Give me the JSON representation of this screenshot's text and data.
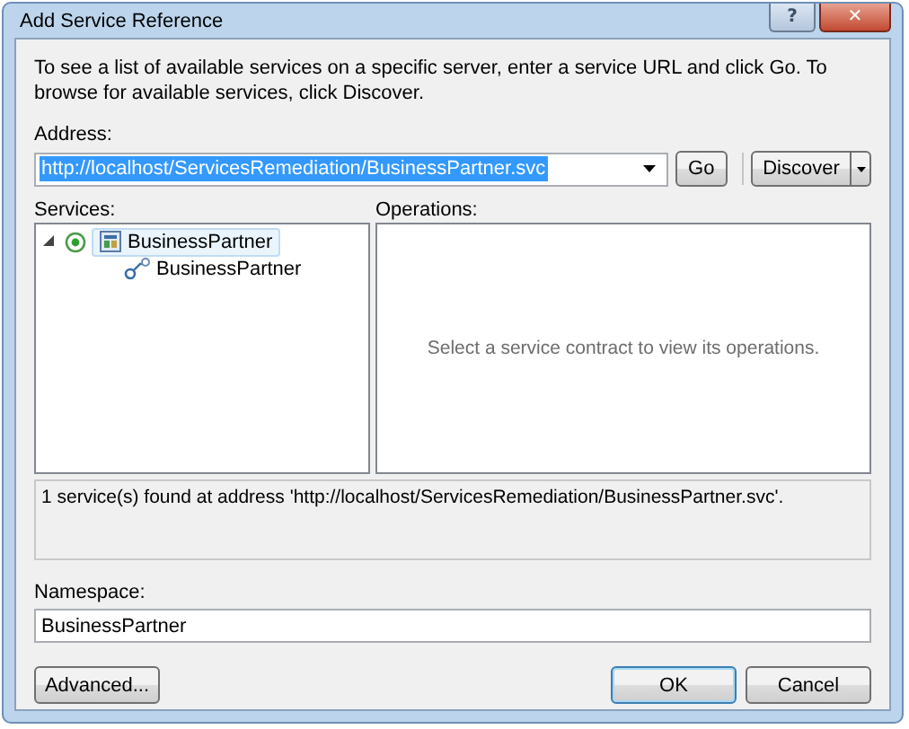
{
  "window": {
    "title": "Add Service Reference",
    "help_button": "?",
    "close_button": "✕"
  },
  "instructions": "To see a list of available services on a specific server, enter a service URL and click Go. To browse for available services, click Discover.",
  "address": {
    "label": "Address:",
    "value": "http://localhost/ServicesRemediation/BusinessPartner.svc",
    "text_selected": true
  },
  "go_button": "Go",
  "discover_button": "Discover",
  "services": {
    "label": "Services:",
    "tree": [
      {
        "label": "BusinessPartner",
        "kind": "service",
        "expanded": true,
        "selected": true,
        "children": [
          {
            "label": "BusinessPartner",
            "kind": "contract",
            "selected": false
          }
        ]
      }
    ]
  },
  "operations": {
    "label": "Operations:",
    "empty_message": "Select a service contract to view its operations."
  },
  "status": "1 service(s) found at address 'http://localhost/ServicesRemediation/BusinessPartner.svc'.",
  "namespace": {
    "label": "Namespace:",
    "value": "BusinessPartner"
  },
  "left_buttons": [
    {
      "label": "Advanced...",
      "default": false
    }
  ],
  "right_buttons": [
    {
      "label": "OK",
      "default": true
    },
    {
      "label": "Cancel",
      "default": false
    }
  ]
}
